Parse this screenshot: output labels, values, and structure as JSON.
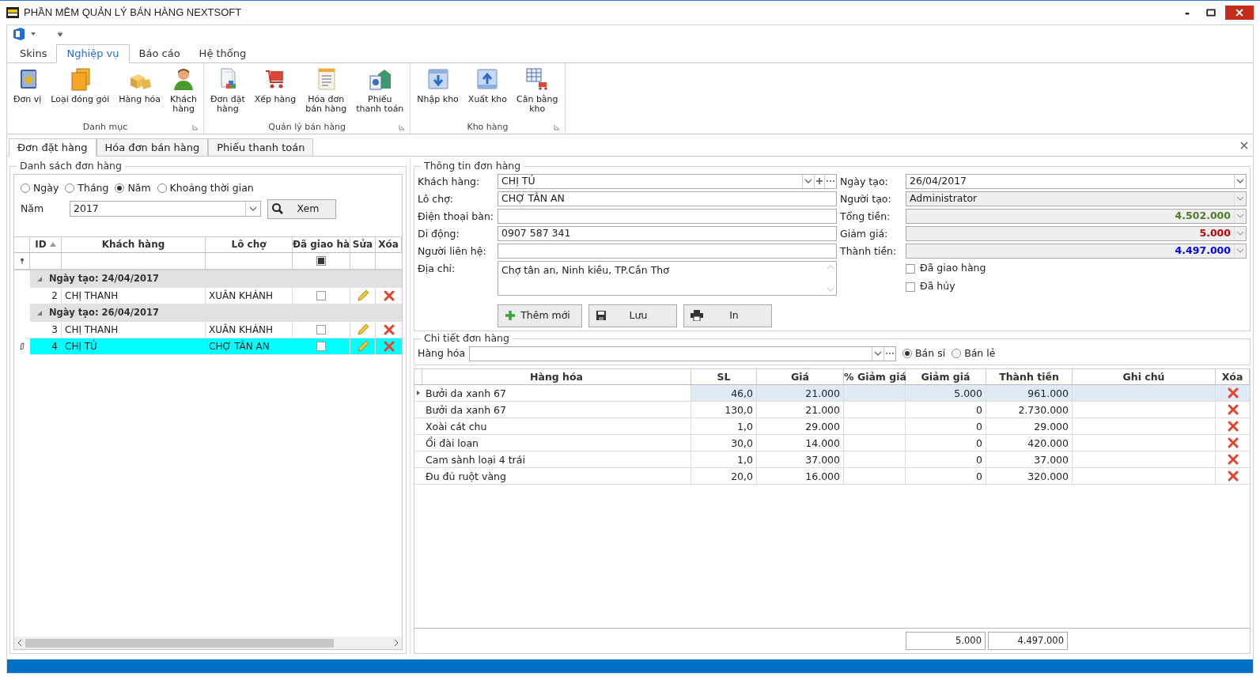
{
  "window": {
    "title": "PHẦN MỀM QUẢN LÝ BÁN HÀNG NEXTSOFT"
  },
  "ribbon": {
    "tabs": [
      {
        "label": "Skins",
        "selected": false
      },
      {
        "label": "Nghiệp vụ",
        "selected": true
      },
      {
        "label": "Báo cáo",
        "selected": false
      },
      {
        "label": "Hệ thống",
        "selected": false
      }
    ],
    "groups": [
      {
        "label": "Danh mục",
        "buttons": [
          {
            "label": "Đơn vị"
          },
          {
            "label": "Loại đóng gói"
          },
          {
            "label": "Hàng hóa"
          },
          {
            "label": "Khách\nhàng"
          }
        ]
      },
      {
        "label": "Quản lý bán hàng",
        "buttons": [
          {
            "label": "Đơn đặt\nhàng"
          },
          {
            "label": "Xếp hàng"
          },
          {
            "label": "Hóa đơn\nbán hàng"
          },
          {
            "label": "Phiếu\nthanh toán"
          }
        ]
      },
      {
        "label": "Kho hàng",
        "buttons": [
          {
            "label": "Nhập kho"
          },
          {
            "label": "Xuất kho"
          },
          {
            "label": "Cân bằng\nkho"
          }
        ]
      }
    ]
  },
  "doc_tabs": [
    {
      "label": "Đơn đặt hàng",
      "selected": true
    },
    {
      "label": "Hóa đơn bán hàng",
      "selected": false
    },
    {
      "label": "Phiếu thanh toán",
      "selected": false
    }
  ],
  "order_list": {
    "title": "Danh sách đơn hàng",
    "filter": {
      "options": [
        {
          "label": "Ngày",
          "selected": false
        },
        {
          "label": "Tháng",
          "selected": false
        },
        {
          "label": "Năm",
          "selected": true
        },
        {
          "label": "Khoảng thời gian",
          "selected": false
        }
      ],
      "year_label": "Năm",
      "year_value": "2017",
      "view_button": "Xem"
    },
    "columns": [
      {
        "label": "ID",
        "sorted": true
      },
      {
        "label": "Khách hàng",
        "sorted": false
      },
      {
        "label": "Lô chợ",
        "sorted": false
      },
      {
        "label": "Đã giao hà",
        "sorted": false
      },
      {
        "label": "Sửa",
        "sorted": false
      },
      {
        "label": "Xóa",
        "sorted": false
      }
    ],
    "filter_row": {
      "delivered_indeterminate": true
    },
    "groups": [
      {
        "label": "Ngày tạo: 24/04/2017",
        "expanded": true,
        "rows": [
          {
            "id": "2",
            "customer": "CHỊ THANH",
            "market": "XUÂN KHÁNH",
            "delivered": false,
            "selected": false
          }
        ]
      },
      {
        "label": "Ngày tạo: 26/04/2017",
        "expanded": true,
        "rows": [
          {
            "id": "3",
            "customer": "CHỊ THANH",
            "market": "XUÂN KHÁNH",
            "delivered": false,
            "selected": false
          },
          {
            "id": "4",
            "customer": "CHỊ TÚ",
            "market": "CHỢ TÂN AN",
            "delivered": false,
            "selected": true
          }
        ]
      }
    ]
  },
  "order_info": {
    "title": "Thông tin đơn hàng",
    "left_fields": [
      {
        "label": "Khách hàng:",
        "value": "CHỊ TÚ",
        "kind": "lookup"
      },
      {
        "label": "Lô chợ:",
        "value": "CHỢ TÂN AN",
        "kind": "text"
      },
      {
        "label": "Điện thoại bàn:",
        "kind": "text"
      },
      {
        "label": "Di động:",
        "value": "0907 587 341",
        "kind": "text"
      },
      {
        "label": "Người liên hệ:",
        "kind": "text"
      },
      {
        "label": "Địa chỉ:",
        "value": "Chợ tân an, Ninh kiều, TP.Cần Thơ",
        "kind": "memo"
      }
    ],
    "right_fields": [
      {
        "label": "Ngày tạo:",
        "value": "26/04/2017",
        "kind": "date"
      },
      {
        "label": "Người tạo:",
        "value": "Administrator",
        "kind": "readonly"
      },
      {
        "label": "Tổng tiền:",
        "value": "4.502.000",
        "kind": "amount",
        "color": "#4f7a28"
      },
      {
        "label": "Giảm giá:",
        "value": "5.000",
        "kind": "amount",
        "color": "#c00000"
      },
      {
        "label": "Thành tiền:",
        "value": "4.497.000",
        "kind": "amount",
        "color": "#0000ff"
      }
    ],
    "checkboxes": [
      {
        "label": "Đã giao hàng",
        "checked": false
      },
      {
        "label": "Đã hủy",
        "checked": false
      }
    ],
    "buttons": [
      {
        "label": "Thêm mới"
      },
      {
        "label": "Lưu"
      },
      {
        "label": "In"
      }
    ]
  },
  "order_details": {
    "title": "Chi tiết đơn hàng",
    "product_label": "Hàng hóa",
    "price_modes": [
      {
        "label": "Bán sỉ",
        "selected": true
      },
      {
        "label": "Bán lẻ",
        "selected": false
      }
    ],
    "columns": [
      "Hàng hóa",
      "SL",
      "Giá",
      "% Giảm giá",
      "Giảm giá",
      "Thành tiền",
      "Ghi chú",
      "Xóa"
    ],
    "rows": [
      {
        "product": "Bưởi da xanh 67",
        "qty": "46,0",
        "price": "21.000",
        "discount": "5.000",
        "total": "961.000",
        "selected": true
      },
      {
        "product": "Bưởi da xanh 67",
        "qty": "130,0",
        "price": "21.000",
        "discount": "0",
        "total": "2.730.000",
        "selected": false
      },
      {
        "product": "Xoài cát chu",
        "qty": "1,0",
        "price": "29.000",
        "discount": "0",
        "total": "29.000",
        "selected": false
      },
      {
        "product": "Ổi đài loan",
        "qty": "30,0",
        "price": "14.000",
        "discount": "0",
        "total": "420.000",
        "selected": false
      },
      {
        "product": "Cam sành loại 4 trái",
        "qty": "1,0",
        "price": "37.000",
        "discount": "0",
        "total": "37.000",
        "selected": false
      },
      {
        "product": "Đu đủ ruột vàng",
        "qty": "20,0",
        "price": "16.000",
        "discount": "0",
        "total": "320.000",
        "selected": false
      }
    ],
    "footer_totals": [
      "5.000",
      "4.497.000"
    ]
  }
}
